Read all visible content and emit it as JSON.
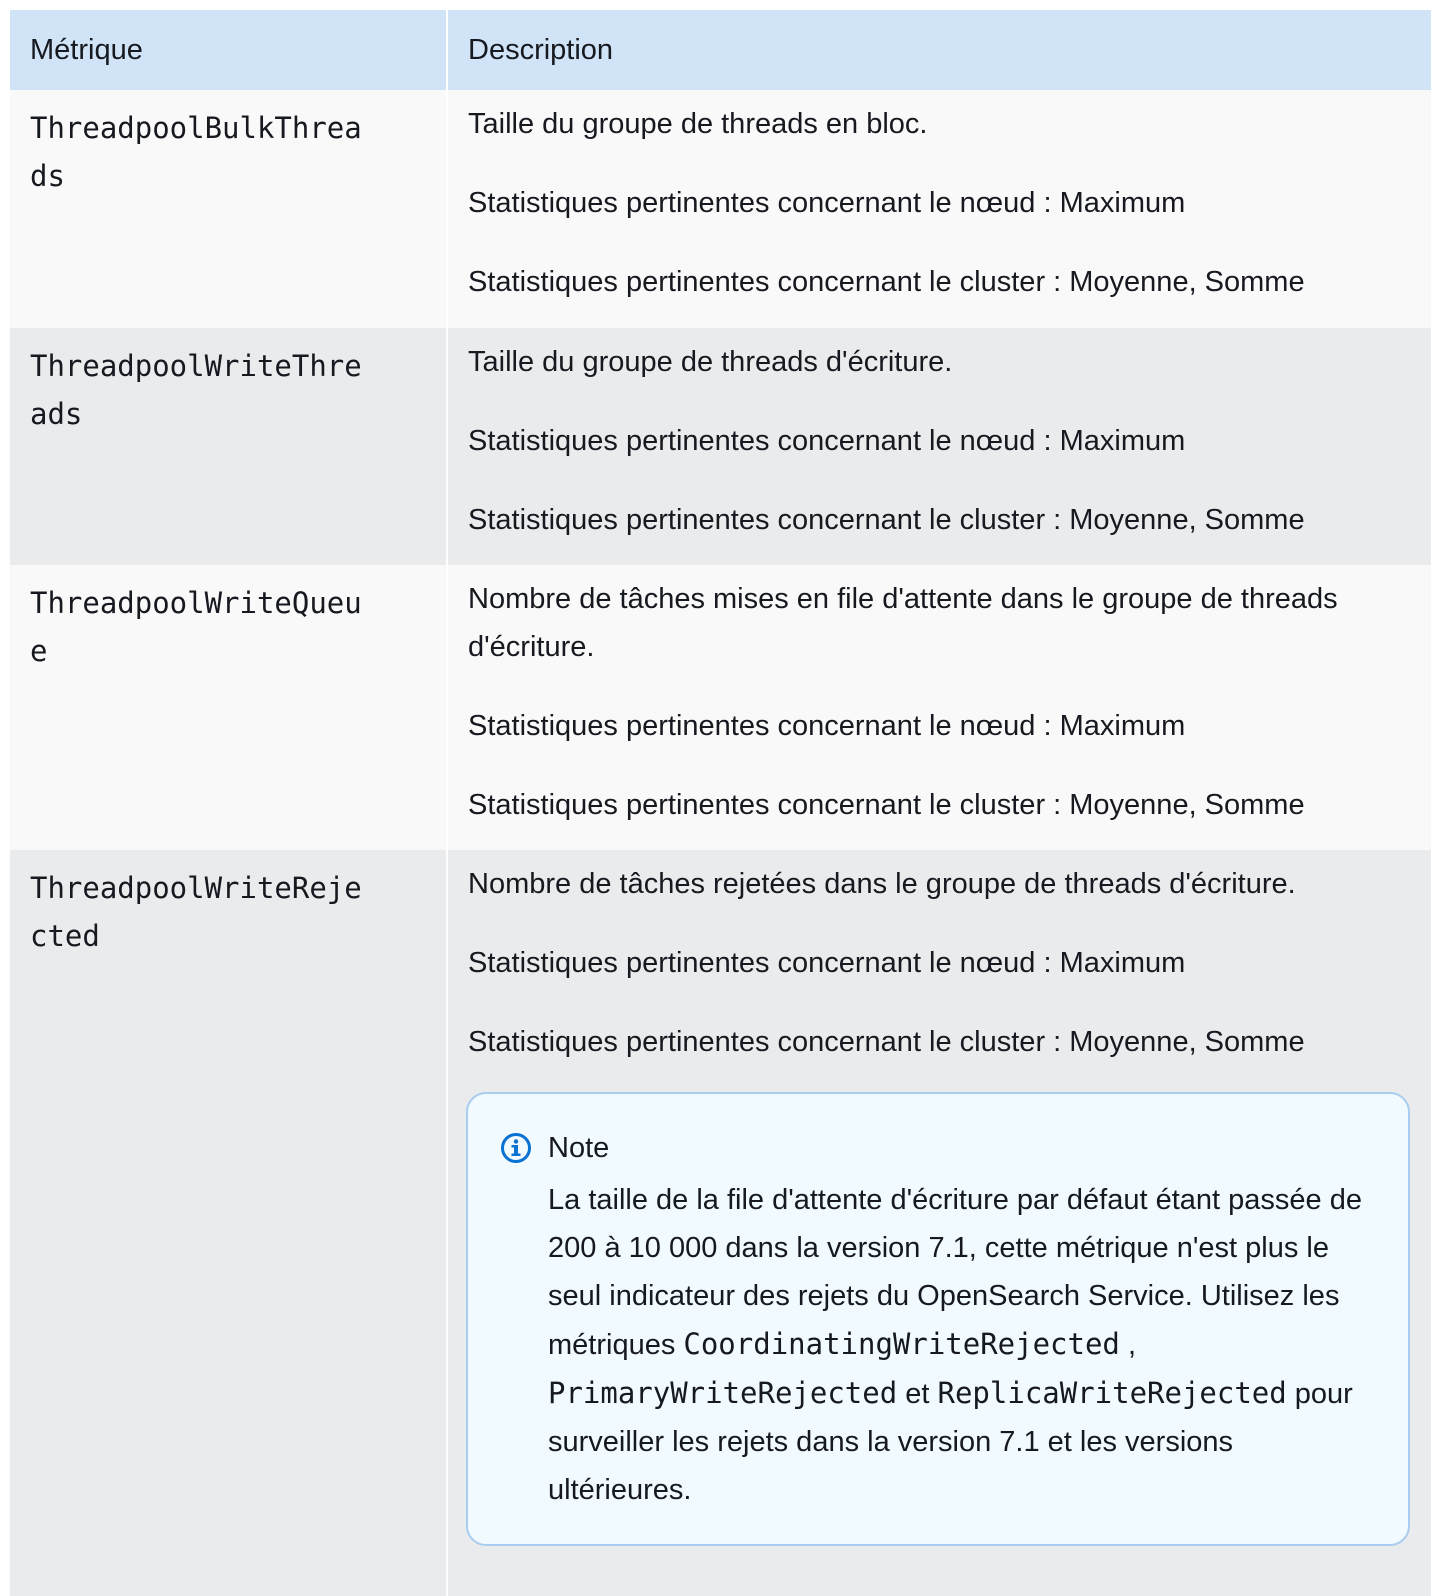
{
  "table": {
    "headers": {
      "metric": "Métrique",
      "description": "Description"
    },
    "rows": [
      {
        "metric": "ThreadpoolBulkThreads",
        "description": "Taille du groupe de threads en bloc.",
        "node_stats": "Statistiques pertinentes concernant le nœud : Maximum",
        "cluster_stats": "Statistiques pertinentes concernant le cluster : Moyenne, Somme"
      },
      {
        "metric": "ThreadpoolWriteThreads",
        "description": "Taille du groupe de threads d'écriture.",
        "node_stats": "Statistiques pertinentes concernant le nœud : Maximum",
        "cluster_stats": "Statistiques pertinentes concernant le cluster : Moyenne, Somme"
      },
      {
        "metric": "ThreadpoolWriteQueue",
        "description": "Nombre de tâches mises en file d'attente dans le groupe de threads d'écriture.",
        "node_stats": "Statistiques pertinentes concernant le nœud : Maximum",
        "cluster_stats": "Statistiques pertinentes concernant le cluster : Moyenne, Somme"
      },
      {
        "metric": "ThreadpoolWriteRejected",
        "description": "Nombre de tâches rejetées dans le groupe de threads d'écriture.",
        "node_stats": "Statistiques pertinentes concernant le nœud : Maximum",
        "cluster_stats": "Statistiques pertinentes concernant le cluster : Moyenne, Somme",
        "note": {
          "icon": "info-icon",
          "title": "Note",
          "text_1": "La taille de la file d'attente d'écriture par défaut étant passée de 200 à 10 000 dans la version 7.1, cette métrique n'est plus le seul indicateur des rejets du OpenSearch Service. Utilisez les métriques ",
          "code_1": "CoordinatingWriteRejected",
          "text_2": " , ",
          "code_2": "PrimaryWriteRejected",
          "text_3": " et ",
          "code_3": "ReplicaWriteRejected",
          "text_4": " pour surveiller les rejets dans la version 7.1 et les versions ultérieures."
        }
      }
    ]
  },
  "colors": {
    "header_bg": "#d1e4f7",
    "row_light": "#f9f9f9",
    "row_dark": "#e9ebed",
    "note_bg": "#f1faff",
    "note_border": "#a9cdef",
    "info_icon": "#0972d3"
  }
}
